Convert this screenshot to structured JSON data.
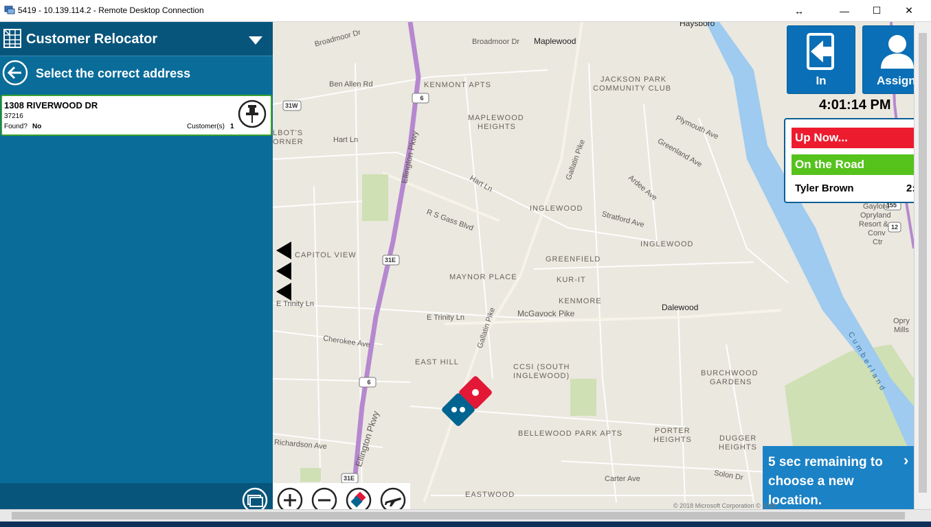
{
  "window": {
    "title": "5419 - 10.139.114.2 - Remote Desktop Connection",
    "resize_glyph": "↔",
    "minimize_glyph": "—",
    "maximize_glyph": "☐",
    "close_glyph": "✕"
  },
  "panel": {
    "title": "Customer Relocator",
    "subtitle": "Select the correct address",
    "result": {
      "address": "1308 RIVERWOOD DR",
      "zip": "37216",
      "found_label": "Found?",
      "found_value": "No",
      "customers_label": "Customer(s)",
      "customers_value": "1"
    }
  },
  "widgets": {
    "tile_in_label": "In",
    "tile_assign_label": "Assign",
    "clock": "4:01:14 PM",
    "status_up_now": "Up Now...",
    "status_on_road": "On the Road",
    "driver_name": "Tyler Brown",
    "driver_time": "2:",
    "toast": "5 sec remaining to choose a new location.",
    "toast_chevron": "›"
  },
  "map": {
    "copyright": "© 2018 Microsoft Corporation  © 2018",
    "labels": {
      "haysboro": "Haysboro",
      "broadmoor1": "Broadmoor Dr",
      "broadmoor2": "Broadmoor Dr",
      "maplewood": "Maplewood",
      "benallen": "Ben Allen Rd",
      "kenmont": "KENMONT APTS",
      "jacksonpark": "JACKSON PARK",
      "community": "COMMUNITY CLUB",
      "maplewoodheights1": "MAPLEWOOD",
      "maplewoodheights2": "HEIGHTS",
      "lbots": "LBOT'S",
      "corner": "ORNER",
      "hartln1": "Hart Ln",
      "hartln2": "Hart Ln",
      "inglewood1": "INGLEWOOD",
      "inglewood2": "INGLEWOOD",
      "capitolview": "CAPITOL VIEW",
      "greenfield": "GREENFIELD",
      "maynorplace": "MAYNOR PLACE",
      "kurit": "KUR-IT",
      "kenmore": "KENMORE",
      "mcgavock": "McGavock Pike",
      "dalewood": "Dalewood",
      "etrinity1": "E Trinity Ln",
      "etrinity2": "E Trinity Ln",
      "cherokee": "Cherokee Ave",
      "easthill": "EAST HILL",
      "ccsi1": "CCSI (SOUTH",
      "ccsi2": "INGLEWOOD)",
      "burchwood1": "BURCHWOOD",
      "burchwood2": "GARDENS",
      "bellewood": "BELLEWOOD PARK APTS",
      "porter1": "PORTER",
      "porter2": "HEIGHTS",
      "dugger1": "DUGGER",
      "dugger2": "HEIGHTS",
      "richardson": "Richardson Ave",
      "eastwood": "EASTWOOD",
      "cartave": "Carter Ave",
      "solon": "Solon Dr",
      "gaylord1": "Gaylord",
      "gaylord2": "Opryland",
      "gaylord3": "Resort &",
      "gaylord4": "Conv",
      "gaylord5": "Ctr",
      "oprymills1": "Opry",
      "oprymills2": "Mills",
      "stratford": "Stratford Ave",
      "plymouth": "Plymouth Ave",
      "greenland": "Greenland Ave",
      "ardee": "Ardee Ave",
      "cumberland": "Cumberland",
      "ellington1": "Ellington Pkwy",
      "ellington2": "Ellington Pkwy",
      "gallatin1": "Gallatin Pike",
      "gallatin2": "Gallatin Pike",
      "rsgass": "R S Gass Blvd",
      "shield6a": "6",
      "shield6b": "6",
      "shield31e1": "31E",
      "shield31e2": "31E",
      "shield31w": "31W",
      "shield155": "155",
      "shield12": "12"
    }
  }
}
